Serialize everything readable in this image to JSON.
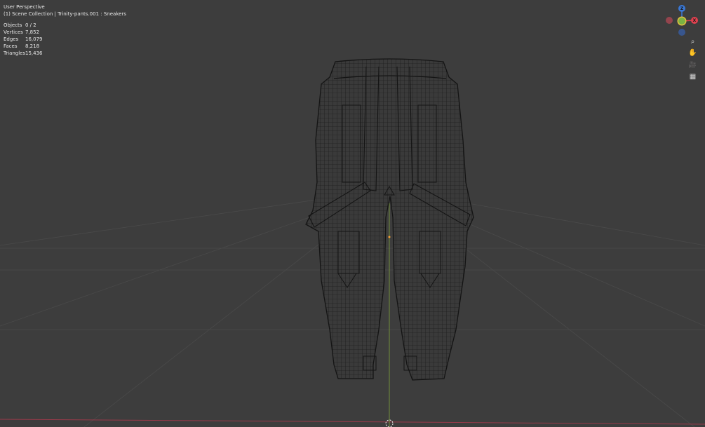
{
  "viewport": {
    "perspective_label": "User Perspective",
    "collection_label": "(1) Scene Collection | Trinity-pants.001 : Sneakers",
    "background": "#3d3d3d",
    "grid_color": "#4a4a4a",
    "x_axis_color": "#9a3a4a",
    "y_axis_color": "#7fa33c",
    "wire_color": "#141414"
  },
  "stats": [
    {
      "label": "Objects",
      "value": "0 / 2"
    },
    {
      "label": "Vertices",
      "value": "7,852"
    },
    {
      "label": "Edges",
      "value": "16,079"
    },
    {
      "label": "Faces",
      "value": "8,218"
    },
    {
      "label": "Triangles",
      "value": "15,436"
    }
  ],
  "gizmo": {
    "z_label": "Z",
    "x_label": "X",
    "z_color": "#3a78d6",
    "x_color": "#e0414f",
    "y_color": "#7cb342",
    "neg_x_color": "#a34550",
    "neg_z_color": "#375a9c"
  },
  "nav_tools": [
    {
      "name": "zoom-icon",
      "glyph": "⌕"
    },
    {
      "name": "pan-hand-icon",
      "glyph": "✋"
    },
    {
      "name": "camera-icon",
      "glyph": "🎥"
    },
    {
      "name": "grid-ortho-icon",
      "glyph": "▦"
    }
  ]
}
